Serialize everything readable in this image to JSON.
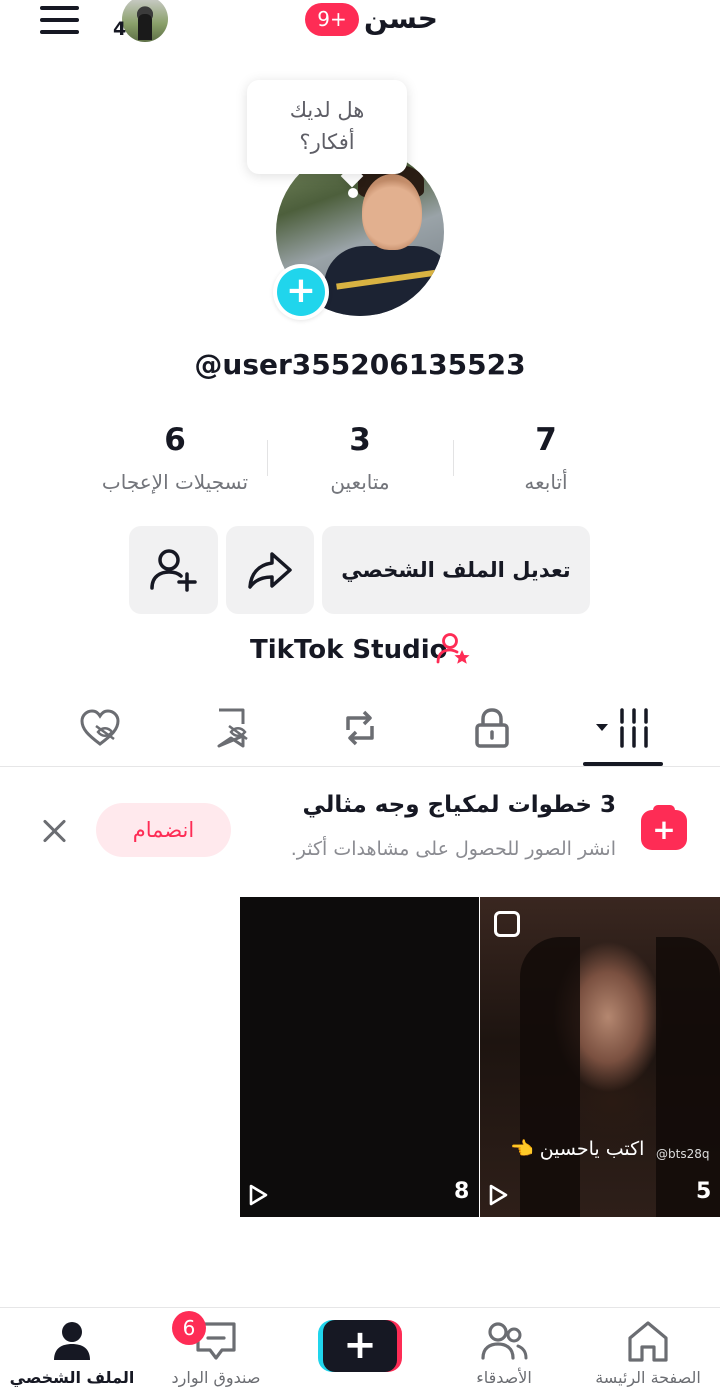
{
  "header": {
    "title": "حسن",
    "notifications_badge": "9+",
    "account_count": "4"
  },
  "tooltip": {
    "line1": "هل لديك",
    "line2": "أفكار؟"
  },
  "profile": {
    "handle": "@user355206135523"
  },
  "stats": {
    "following": {
      "value": "7",
      "label": "أتابعه"
    },
    "followers": {
      "value": "3",
      "label": "متابعين"
    },
    "likes": {
      "value": "6",
      "label": "تسجيلات الإعجاب"
    }
  },
  "actions": {
    "edit_profile": "تعديل الملف الشخصي"
  },
  "studio": {
    "label": "TikTok Studio"
  },
  "tabs": [
    "videos-grid-icon",
    "lock-icon",
    "repost-icon",
    "saved-icon",
    "liked-icon"
  ],
  "promo": {
    "title": "3 خطوات لمكياج وجه مثالي",
    "subtitle": "انشر الصور للحصول على مشاهدات أكثر.",
    "join": "انضمام"
  },
  "videos": [
    {
      "views": "5",
      "caption": "اكتب ياحسين 👈",
      "watermark": "@bts28q"
    },
    {
      "views": "8"
    }
  ],
  "bottom_nav": {
    "home": "الصفحة الرئيسة",
    "friends": "الأصدقاء",
    "inbox": "صندوق الوارد",
    "inbox_badge": "6",
    "profile": "الملف الشخصي"
  },
  "colors": {
    "accent_red": "#fe2c55",
    "accent_cyan": "#20d5ec",
    "text_primary": "#161823",
    "button_bg": "#f1f1f2"
  }
}
